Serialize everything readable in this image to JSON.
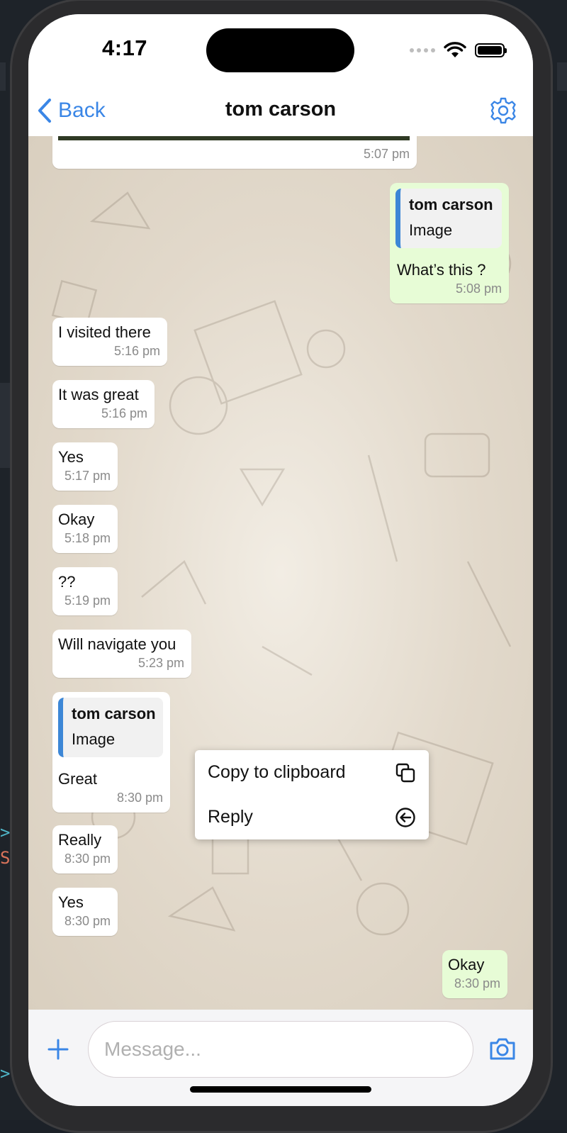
{
  "status_bar": {
    "time": "4:17"
  },
  "nav": {
    "back_label": "Back",
    "title": "tom carson",
    "back_icon": "chevron-left-icon",
    "settings_icon": "gear-icon"
  },
  "colors": {
    "accent": "#3a86e6",
    "incoming_bubble": "#ffffff",
    "outgoing_bubble": "#e7fcd6",
    "quote_bar": "#3d87d6"
  },
  "messages": [
    {
      "direction": "in",
      "text": "",
      "time": "5:07 pm",
      "partial_image": true
    },
    {
      "direction": "out",
      "quote": {
        "name": "tom carson",
        "body": "Image"
      },
      "text": "What’s this ?",
      "time": "5:08 pm"
    },
    {
      "direction": "in",
      "text": "I visited there",
      "time": "5:16 pm"
    },
    {
      "direction": "in",
      "text": "It was great",
      "time": "5:16 pm"
    },
    {
      "direction": "in",
      "text": "Yes",
      "time": "5:17 pm"
    },
    {
      "direction": "in",
      "text": "Okay",
      "time": "5:18 pm"
    },
    {
      "direction": "in",
      "text": "??",
      "time": "5:19 pm"
    },
    {
      "direction": "in",
      "text": "Will navigate you",
      "time": "5:23 pm"
    },
    {
      "direction": "in",
      "quote": {
        "name": "tom carson",
        "body": "Image"
      },
      "text": "Great",
      "time": "8:30 pm"
    },
    {
      "direction": "in",
      "text": "Really",
      "time": "8:30 pm"
    },
    {
      "direction": "in",
      "text": "Yes",
      "time": "8:30 pm"
    },
    {
      "direction": "out",
      "text": "Okay",
      "time": "8:30 pm"
    }
  ],
  "context_menu": {
    "items": [
      {
        "label": "Copy to clipboard",
        "icon": "copy-icon"
      },
      {
        "label": "Reply",
        "icon": "reply-icon"
      }
    ]
  },
  "composer": {
    "placeholder": "Message...",
    "add_icon": "plus-icon",
    "camera_icon": "camera-icon"
  }
}
